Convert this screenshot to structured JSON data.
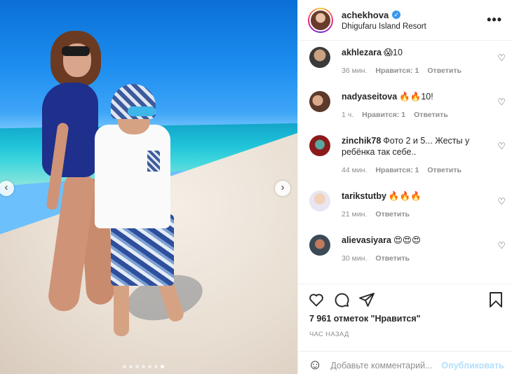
{
  "post": {
    "username": "achekhova",
    "verified_icon": "verified-badge-icon",
    "location": "Dhigufaru Island Resort",
    "more_icon": "more-options-icon"
  },
  "carousel": {
    "prev_icon": "chevron-left-icon",
    "next_icon": "chevron-right-icon",
    "dots_count": 7,
    "active_dot": 6
  },
  "comments": [
    {
      "user": "akhlezara",
      "text": "😱10",
      "time": "36 мин.",
      "likes": "Нравится: 1",
      "reply": "Ответить"
    },
    {
      "user": "nadyaseitova",
      "text": "🔥🔥10!",
      "time": "1 ч.",
      "likes": "Нравится: 1",
      "reply": "Ответить"
    },
    {
      "user": "zinchik78",
      "text": "Фото 2 и 5... Жесты у ребёнка так себе..",
      "time": "44 мин.",
      "likes": "Нравится: 1",
      "reply": "Ответить"
    },
    {
      "user": "tarikstutby",
      "text": "🔥🔥🔥",
      "time": "21 мин.",
      "likes": "",
      "reply": "Ответить"
    },
    {
      "user": "alievasiyara",
      "text": "😍😍😍",
      "time": "30 мин.",
      "likes": "",
      "reply": "Ответить"
    }
  ],
  "actions": {
    "like_icon": "heart-icon",
    "comment_icon": "comment-icon",
    "share_icon": "send-icon",
    "save_icon": "bookmark-icon",
    "likes_text": "7 961 отметок \"Нравится\"",
    "time_ago": "ЧАС НАЗАД"
  },
  "add_comment": {
    "emoji_icon": "smiley-icon",
    "placeholder": "Добавьте комментарий...",
    "post_label": "Опубликовать"
  }
}
